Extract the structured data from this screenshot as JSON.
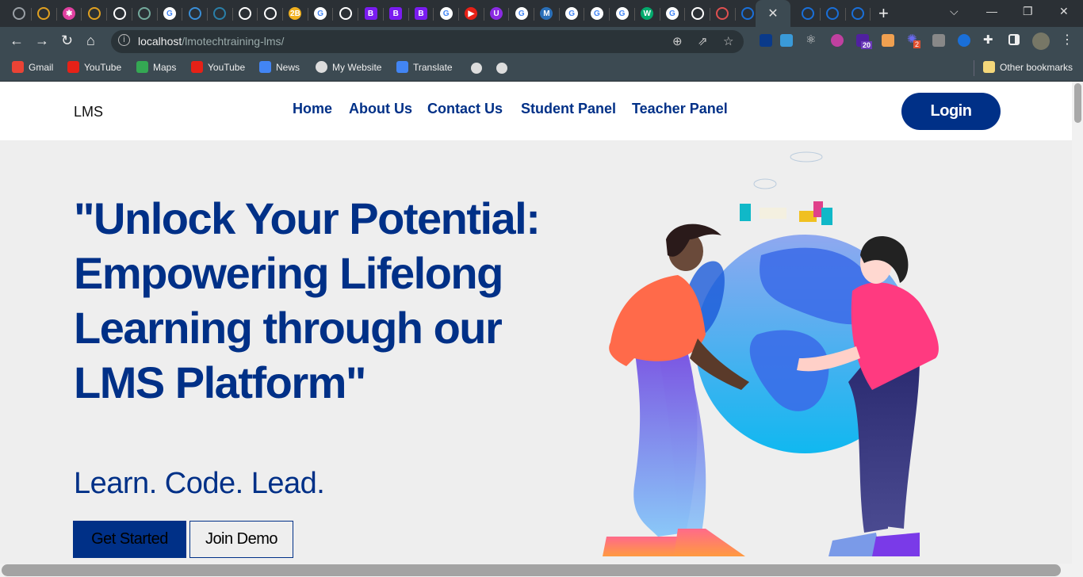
{
  "browser": {
    "tabs": [
      {
        "icon": "globe-icon",
        "color": "#9aa0a6",
        "g": ""
      },
      {
        "icon": "rings-icon",
        "color": "#e0a020",
        "g": ""
      },
      {
        "icon": "star-burst-icon",
        "color": "#e040a0",
        "g": "✱"
      },
      {
        "icon": "rings-icon",
        "color": "#e0a020",
        "g": ""
      },
      {
        "icon": "chrome-icon",
        "color": "#ffffff",
        "g": ""
      },
      {
        "icon": "chatgpt-icon",
        "color": "#74aa9c",
        "g": ""
      },
      {
        "icon": "google-icon",
        "color": "#4285f4",
        "g": "G"
      },
      {
        "icon": "stack-icon",
        "color": "#3a8fd8",
        "g": ""
      },
      {
        "icon": "eye-icon",
        "color": "#2a7fa8",
        "g": ""
      },
      {
        "icon": "chrome-icon",
        "color": "#ffffff",
        "g": ""
      },
      {
        "icon": "chrome-icon",
        "color": "#ffffff",
        "g": ""
      },
      {
        "icon": "2b-icon",
        "color": "#f0b020",
        "g": "2B"
      },
      {
        "icon": "google-icon",
        "color": "#4285f4",
        "g": "G"
      },
      {
        "icon": "chrome-icon",
        "color": "#ffffff",
        "g": ""
      },
      {
        "icon": "bootstrap-icon",
        "color": "#7a1cf0",
        "g": "B"
      },
      {
        "icon": "bootstrap-icon",
        "color": "#7a1cf0",
        "g": "B"
      },
      {
        "icon": "bootstrap-icon",
        "color": "#7a1cf0",
        "g": "B"
      },
      {
        "icon": "google-icon",
        "color": "#4285f4",
        "g": "G"
      },
      {
        "icon": "youtube-icon",
        "color": "#e62117",
        "g": "▶"
      },
      {
        "icon": "u-icon",
        "color": "#8a2be2",
        "g": "U"
      },
      {
        "icon": "google-icon",
        "color": "#4285f4",
        "g": "G"
      },
      {
        "icon": "mdb-icon",
        "color": "#2a6fb8",
        "g": "M"
      },
      {
        "icon": "google-icon",
        "color": "#4285f4",
        "g": "G"
      },
      {
        "icon": "google-icon",
        "color": "#4285f4",
        "g": "G"
      },
      {
        "icon": "google-icon",
        "color": "#4285f4",
        "g": "G"
      },
      {
        "icon": "w3schools-icon",
        "color": "#04aa6d",
        "g": "W"
      },
      {
        "icon": "google-icon",
        "color": "#4285f4",
        "g": "G"
      },
      {
        "icon": "chrome-icon",
        "color": "#ffffff",
        "g": ""
      },
      {
        "icon": "store-icon",
        "color": "#e05050",
        "g": ""
      },
      {
        "icon": "firefox-icon",
        "color": "#1a6fd8",
        "g": ""
      },
      {
        "icon": "close-icon",
        "color": "#dddddd",
        "g": "✕",
        "active": true
      },
      {
        "icon": "firefox-icon",
        "color": "#1a6fd8",
        "g": ""
      },
      {
        "icon": "firefox-icon",
        "color": "#1a6fd8",
        "g": ""
      },
      {
        "icon": "firefox-icon",
        "color": "#1a6fd8",
        "g": ""
      }
    ],
    "url_host": "localhost",
    "url_path": "/lmotechtraining-lms/",
    "bookmarks": [
      {
        "label": "Gmail",
        "icon": "gmail-icon",
        "color": "#ea4335"
      },
      {
        "label": "YouTube",
        "icon": "youtube-icon",
        "color": "#e62117"
      },
      {
        "label": "Maps",
        "icon": "maps-icon",
        "color": "#34a853"
      },
      {
        "label": "YouTube",
        "icon": "youtube-icon",
        "color": "#e62117"
      },
      {
        "label": "News",
        "icon": "news-icon",
        "color": "#4285f4"
      },
      {
        "label": "My Website",
        "icon": "globe-icon",
        "color": "#dddddd"
      },
      {
        "label": "Translate",
        "icon": "translate-icon",
        "color": "#4285f4"
      }
    ],
    "other_bookmarks": "Other bookmarks",
    "ext_badges": {
      "graduation": "20",
      "spark": "2"
    }
  },
  "site": {
    "logo": "LMS",
    "nav": [
      "Home",
      "About Us",
      "Contact Us",
      "Student Panel",
      "Teacher Panel"
    ],
    "login": "Login",
    "headline": "\"Unlock Your Potential: Empowering Lifelong Learning through our LMS Platform\"",
    "subtitle": "Learn. Code. Lead.",
    "get_started": "Get Started",
    "join_demo": "Join Demo",
    "accent": "#003087"
  }
}
